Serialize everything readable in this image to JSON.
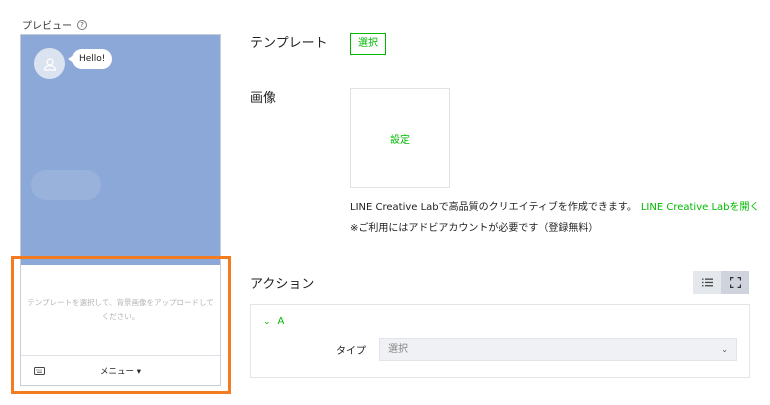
{
  "preview": {
    "label": "プレビュー",
    "help_glyph": "?",
    "bubble_text": "Hello!",
    "placeholder_text": "テンプレートを選択して、背景画像をアップロードしてください。",
    "menu_label": "メニュー ▾"
  },
  "template": {
    "label": "テンプレート",
    "select_button": "選択"
  },
  "image": {
    "label": "画像",
    "set_label": "設定",
    "info_text": "LINE Creative Labで高品質のクリエイティブを作成できます。",
    "info_link": "LINE Creative Labを開く",
    "note": "※ご利用にはアドビアカウントが必要です（登録無料）"
  },
  "action": {
    "label": "アクション",
    "item_name": "A",
    "type_label": "タイプ",
    "type_value": "選択"
  },
  "colors": {
    "accent_green": "#00b900",
    "highlight_orange": "#f47c20",
    "chat_background": "#8ba8d8"
  },
  "icons": {
    "keyboard": "keyboard-icon",
    "list_view": "list-icon",
    "fullscreen": "fullscreen-icon",
    "avatar": "user-icon"
  }
}
